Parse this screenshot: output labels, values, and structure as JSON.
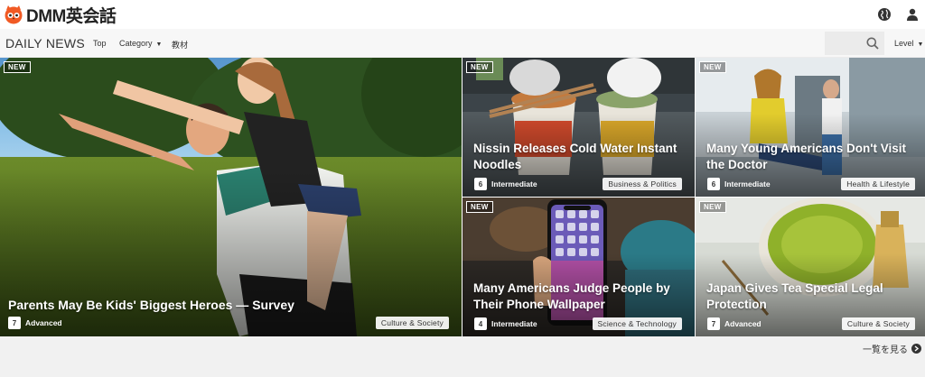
{
  "header": {
    "logo_text": "DMM英会話",
    "brand_color": "#f15a24"
  },
  "subnav": {
    "brand": "DAILY NEWS",
    "items": [
      {
        "label": "Top"
      },
      {
        "label": "Category"
      },
      {
        "label": "教材"
      }
    ],
    "level_label": "Level"
  },
  "articles": [
    {
      "new": "NEW",
      "title": "Parents May Be Kids' Biggest Heroes — Survey",
      "level_num": "7",
      "level": "Advanced",
      "category": "Culture & Society"
    },
    {
      "new": "NEW",
      "title_line1": "Nissin Releases Cold Water Instant",
      "title_line2": "Noodles",
      "level_num": "6",
      "level": "Intermediate",
      "category": "Business & Politics"
    },
    {
      "new": "NEW",
      "title_line1": "Many Young Americans Don't Visit",
      "title_line2": "the Doctor",
      "level_num": "6",
      "level": "Intermediate",
      "category": "Health & Lifestyle"
    },
    {
      "new": "NEW",
      "title_line1": "Many Americans Judge People by",
      "title_line2": "Their Phone Wallpaper",
      "level_num": "4",
      "level": "Intermediate",
      "category": "Science & Technology"
    },
    {
      "new": "NEW",
      "title_line1": "Japan Gives Tea Special Legal",
      "title_line2": "Protection",
      "level_num": "7",
      "level": "Advanced",
      "category": "Culture & Society"
    }
  ],
  "more_label": "一覧を見る"
}
